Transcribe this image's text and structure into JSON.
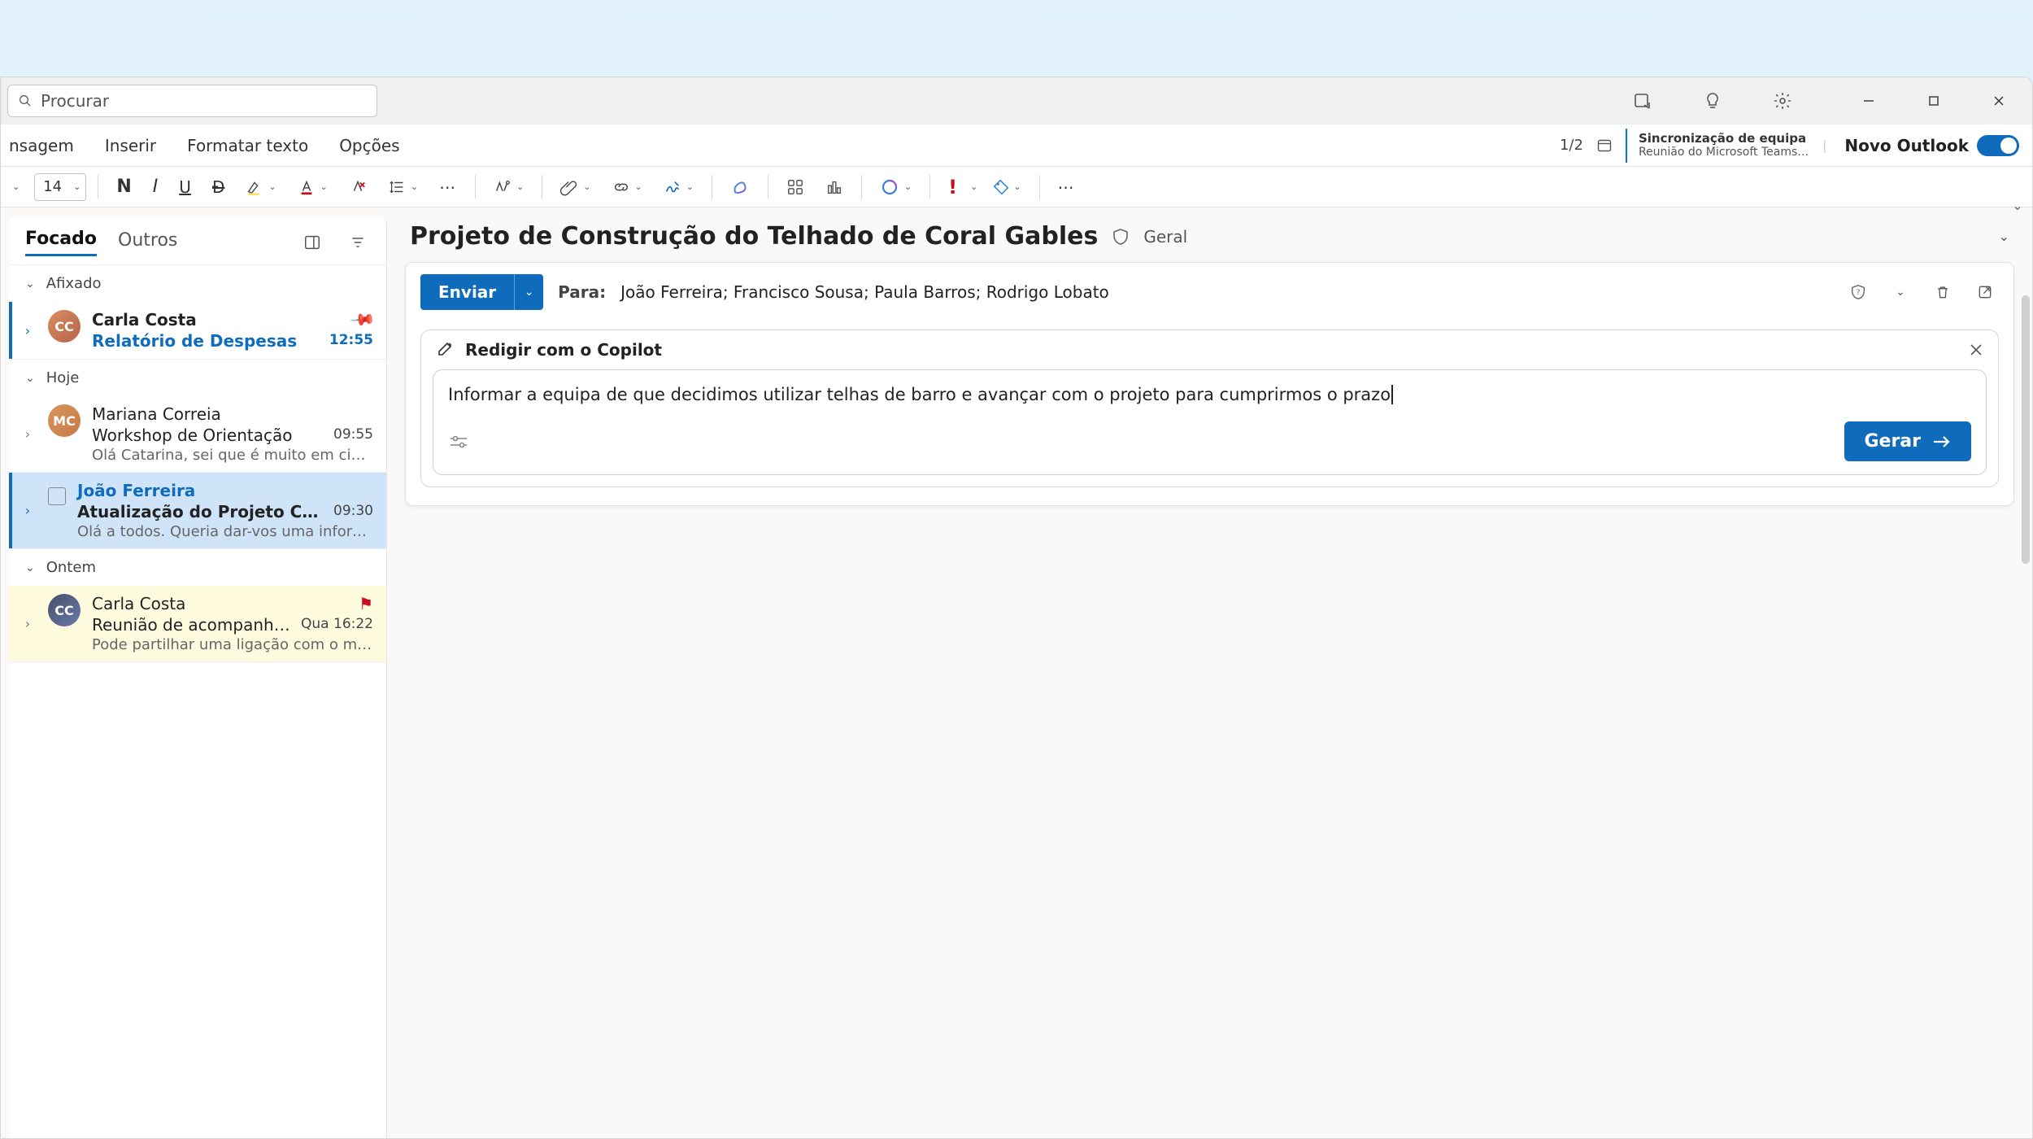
{
  "titlebar": {
    "search_placeholder": "Procurar"
  },
  "ribbon": {
    "tabs": [
      "nsagem",
      "Inserir",
      "Formatar texto",
      "Opções"
    ],
    "counter": "1/2",
    "calendar_title": "Sincronização de equipa",
    "calendar_sub": "Reunião do Microsoft Teams d…",
    "toggle_label": "Novo Outlook"
  },
  "format": {
    "font_size": "14"
  },
  "list": {
    "tab_focused": "Focado",
    "tab_other": "Outros",
    "section_pinned": "Afixado",
    "section_today": "Hoje",
    "section_yesterday": "Ontem",
    "items": [
      {
        "sender": "Carla Costa",
        "subject": "Relatório de Despesas",
        "time": "12:55"
      },
      {
        "sender": "Mariana Correia",
        "subject": "Workshop de Orientação",
        "preview": "Olá Catarina, sei que é muito em cima d…",
        "time": "09:55"
      },
      {
        "sender": "João Ferreira",
        "subject": "Atualização do Projeto Coral Gables",
        "preview": "Olá a todos. Queria dar-vos uma informaç…",
        "time": "09:30"
      },
      {
        "sender": "Carla Costa",
        "subject": "Reunião de acompanhamento d…",
        "preview": "Pode partilhar uma ligação com o market…",
        "time": "Qua 16:22"
      }
    ]
  },
  "reading": {
    "subject": "Projeto de Construção do Telhado de Coral Gables",
    "tag": "Geral",
    "send_label": "Enviar",
    "to_label": "Para:",
    "to_value": "João Ferreira; Francisco Sousa; Paula Barros; Rodrigo Lobato",
    "copilot_title": "Redigir com o Copilot",
    "copilot_prompt": "Informar a equipa de que decidimos utilizar telhas de barro e avançar com o projeto para cumprirmos o prazo",
    "generate_label": "Gerar"
  }
}
